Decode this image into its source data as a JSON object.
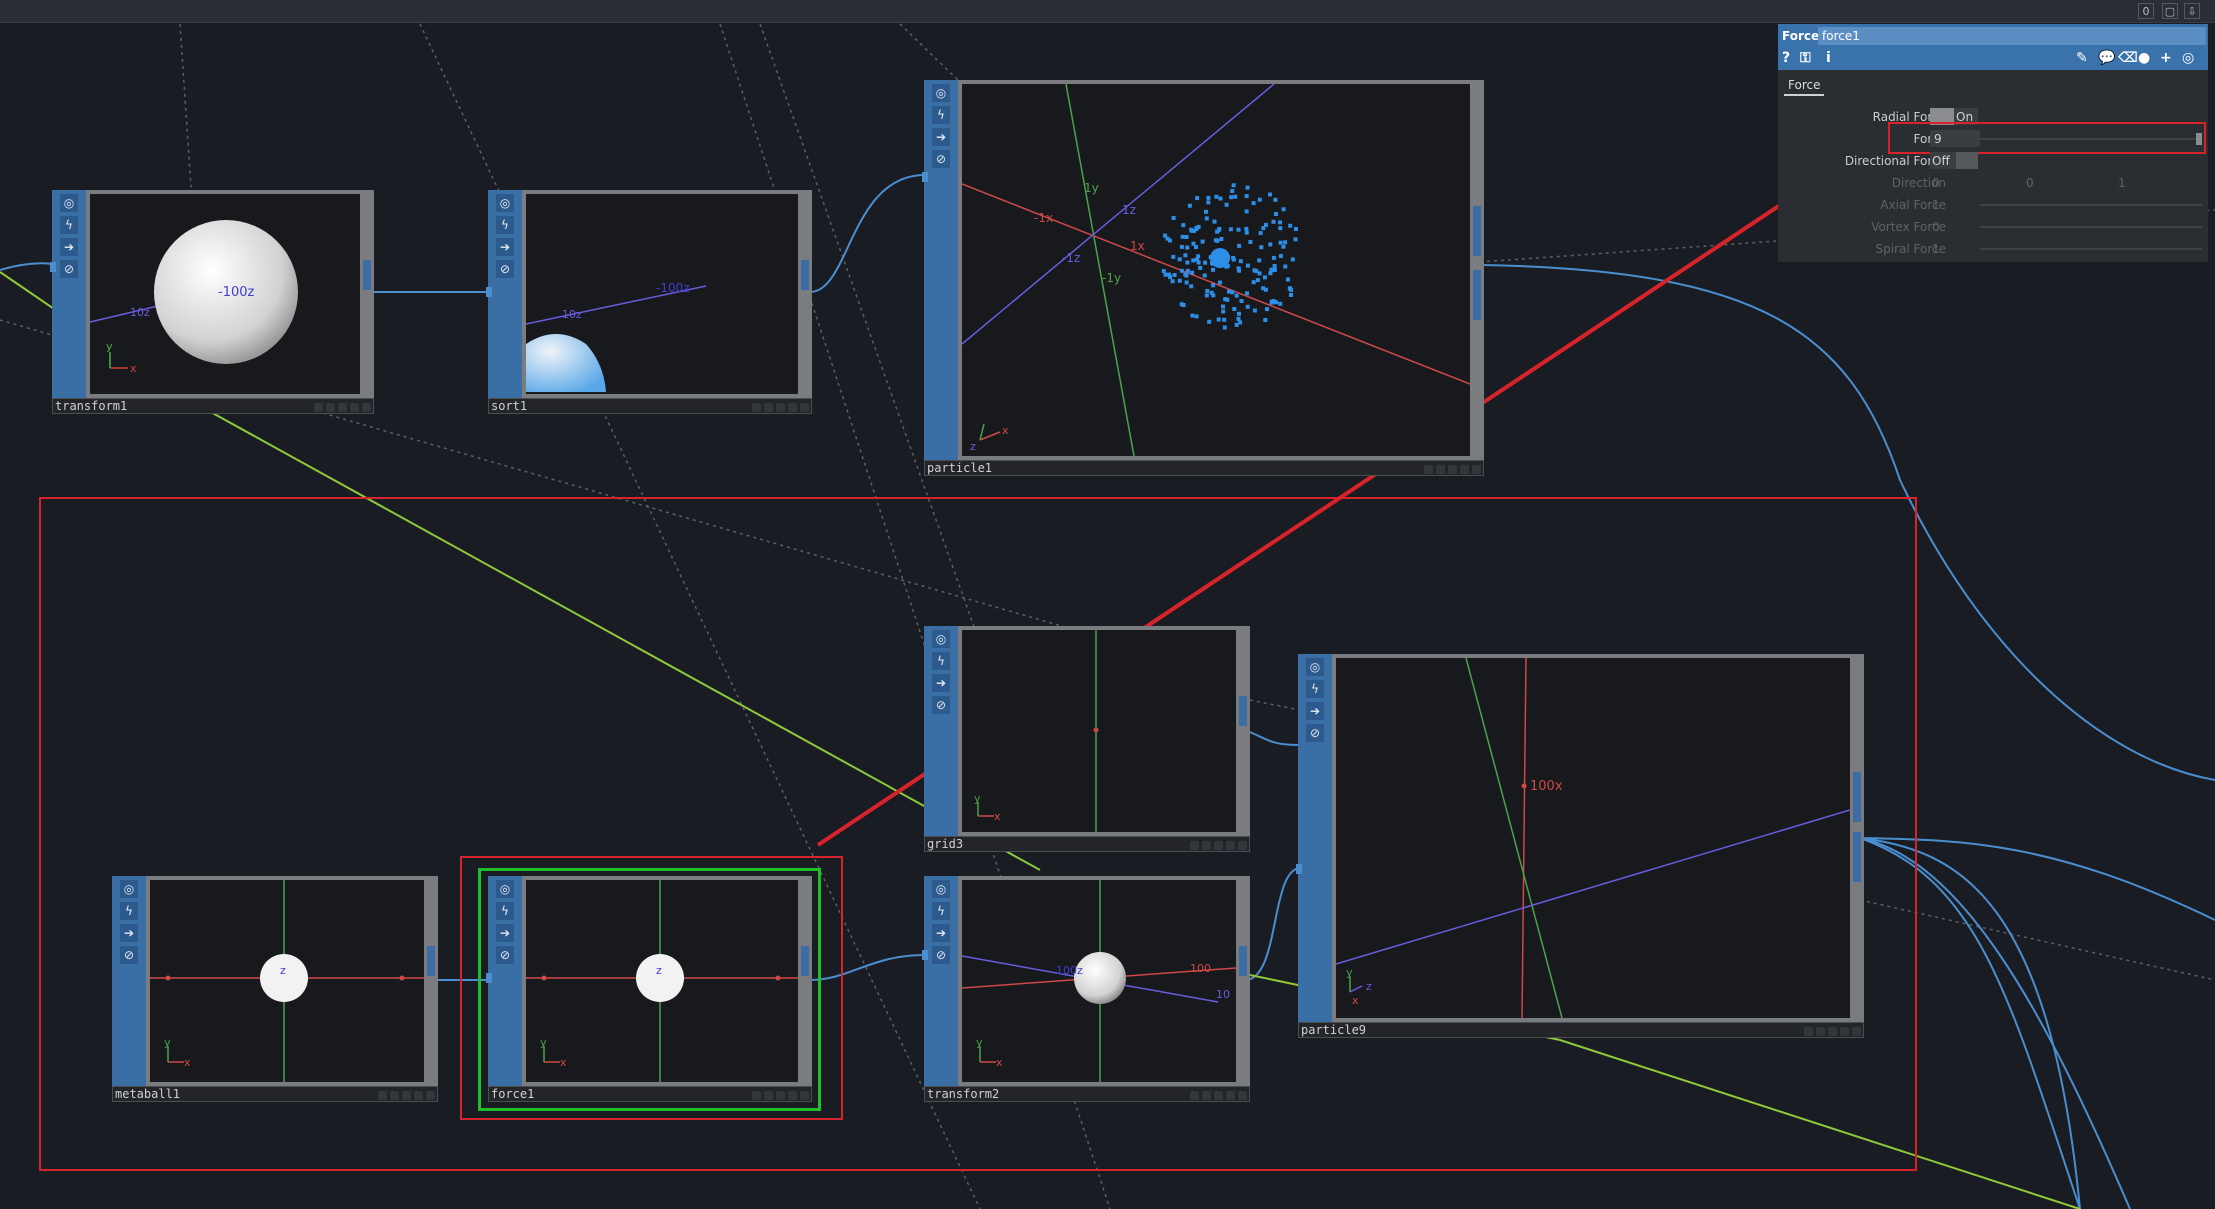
{
  "topbar": {
    "counter": "0",
    "window_icon": "window-icon",
    "pin_icon": "pin-icon"
  },
  "nodes": {
    "transform1": {
      "label": "transform1",
      "axis_labels": [
        "-100z",
        "10z",
        "x",
        "y"
      ]
    },
    "sort1": {
      "label": "sort1",
      "axis_labels": [
        "-100z",
        "10z"
      ]
    },
    "particle1": {
      "label": "particle1",
      "axis_labels": [
        "1y",
        "1z",
        "-1x",
        "1x",
        "-1z",
        "-1y",
        "x",
        "z"
      ]
    },
    "grid3": {
      "label": "grid3",
      "axis_labels": [
        "x",
        "y"
      ]
    },
    "particle9": {
      "label": "particle9",
      "axis_labels": [
        "100x",
        "x",
        "z",
        "y"
      ]
    },
    "metaball1": {
      "label": "metaball1",
      "axis_labels": [
        "z",
        "x",
        "y"
      ]
    },
    "force1": {
      "label": "force1",
      "axis_labels": [
        "z",
        "x",
        "y"
      ]
    },
    "transform2": {
      "label": "transform2",
      "axis_labels": [
        "100z",
        "100",
        "10",
        "x",
        "y"
      ]
    }
  },
  "node_buttons": [
    "target-icon",
    "flash-icon",
    "arrow-right-icon",
    "lock-icon"
  ],
  "panel": {
    "op_type": "Force",
    "op_name": "force1",
    "tab": "Force",
    "params": [
      {
        "label": "Radial Force",
        "value": "On",
        "kind": "toggle"
      },
      {
        "label": "Force",
        "value": "9",
        "kind": "slider"
      },
      {
        "label": "Directional Force",
        "value": "Off",
        "kind": "toggle"
      },
      {
        "label": "Direction",
        "value": "0",
        "value2": "0",
        "value3": "1",
        "kind": "vector"
      },
      {
        "label": "Axial Force",
        "value": "1",
        "kind": "slider"
      },
      {
        "label": "Vortex Force",
        "value": "0",
        "kind": "slider"
      },
      {
        "label": "Spiral Force",
        "value": "1",
        "kind": "slider"
      }
    ]
  },
  "colors": {
    "annotation_red": "#d8232a",
    "selection_green": "#1fbf2a",
    "wire_blue": "#4a8ed0",
    "wire_green": "#8fc93a",
    "node_strip": "#3a6fa6"
  }
}
